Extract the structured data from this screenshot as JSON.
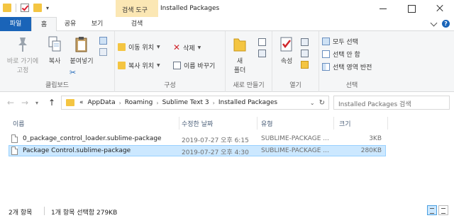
{
  "window": {
    "title": "Installed Packages",
    "context_tab": "검색 도구"
  },
  "tabs": {
    "file": "파일",
    "home": "홈",
    "share": "공유",
    "view": "보기",
    "search": "검색"
  },
  "ribbon": {
    "clipboard": {
      "label": "클립보드",
      "pin": "바로 가기에\n고정",
      "pin_line1": "바로 가기에",
      "pin_line2": "고정",
      "copy": "복사",
      "paste": "붙여넣기"
    },
    "organize": {
      "label": "구성",
      "move_to": "이동 위치",
      "copy_to": "복사 위치",
      "delete": "삭제",
      "rename": "이름 바꾸기"
    },
    "new": {
      "label": "새로 만들기",
      "new_folder_line1": "새",
      "new_folder_line2": "폴더"
    },
    "open": {
      "label": "열기",
      "properties": "속성"
    },
    "select": {
      "label": "선택",
      "select_all": "모두 선택",
      "select_none": "선택 안 함",
      "invert": "선택 영역 반전"
    }
  },
  "address": {
    "overflow": "«",
    "crumbs": [
      "AppData",
      "Roaming",
      "Sublime Text 3",
      "Installed Packages"
    ]
  },
  "search": {
    "placeholder": "Installed Packages 검색"
  },
  "columns": {
    "name": "이름",
    "date": "수정한 날짜",
    "type": "유형",
    "size": "크기"
  },
  "files": [
    {
      "name": "0_package_control_loader.sublime-package",
      "date": "2019-07-27 오후 6:15",
      "type": "SUBLIME-PACKAGE ...",
      "size": "3KB",
      "selected": false
    },
    {
      "name": "Package Control.sublime-package",
      "date": "2019-07-27 오후 4:30",
      "type": "SUBLIME-PACKAGE ...",
      "size": "280KB",
      "selected": true
    }
  ],
  "status": {
    "count": "2개 항목",
    "selection": "1개 항목 선택함 279KB"
  }
}
